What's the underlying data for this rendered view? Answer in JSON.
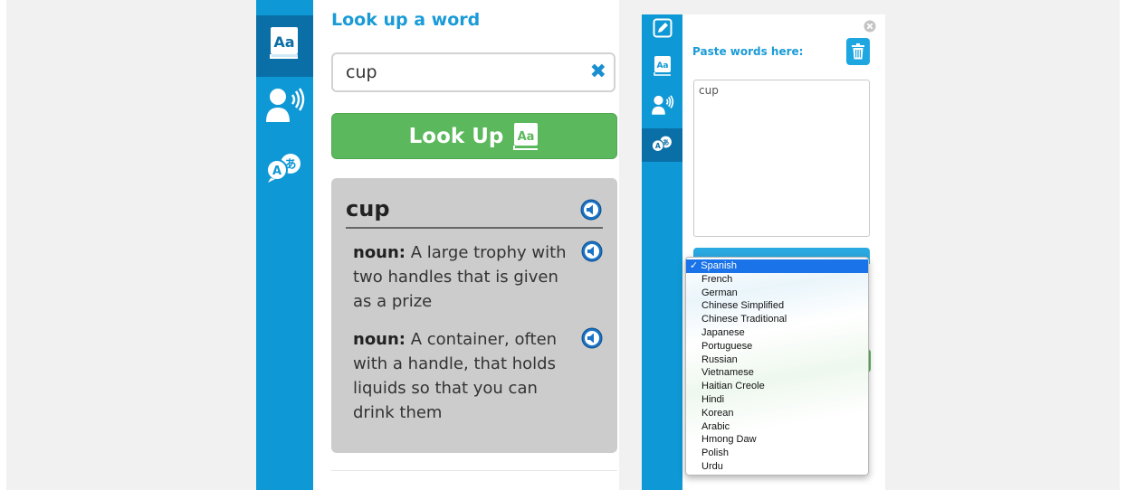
{
  "left_panel": {
    "title": "Look up a word",
    "search": {
      "value": "cup",
      "clear_icon": "✖"
    },
    "lookup_button": {
      "label": "Look Up"
    },
    "definition": {
      "word": "cup",
      "entries": [
        {
          "pos": "noun:",
          "text": " A large trophy with two handles that is given as a prize"
        },
        {
          "pos": "noun:",
          "text": " A container, often with a handle, that holds liquids so that you can drink them"
        }
      ]
    },
    "rail_icons": [
      "dictionary-icon",
      "speaker-person-icon",
      "translate-icon"
    ]
  },
  "right_panel": {
    "paste_label": "Paste words here:",
    "paste_value": "cup",
    "rail_icons": [
      "edit-icon",
      "dictionary-icon",
      "speaker-person-icon",
      "translate-icon"
    ],
    "language_dropdown": {
      "selected": "Spanish",
      "options": [
        "Spanish",
        "French",
        "German",
        "Chinese Simplified",
        "Chinese Traditional",
        "Japanese",
        "Portuguese",
        "Russian",
        "Vietnamese",
        "Haitian Creole",
        "Hindi",
        "Korean",
        "Arabic",
        "Hmong Daw",
        "Polish",
        "Urdu"
      ]
    }
  },
  "colors": {
    "rail": "#0e98d5",
    "rail_active": "#0a6fa6",
    "accent": "#1a9bd7",
    "button_green": "#5cb85c",
    "card_gray": "#cccccc"
  }
}
